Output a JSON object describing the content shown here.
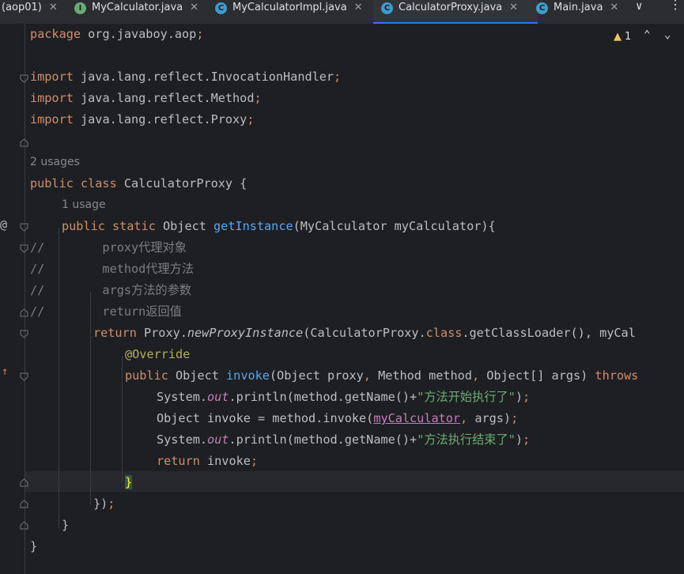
{
  "tabs": [
    {
      "label": "(aop01)",
      "icon": "",
      "active": false
    },
    {
      "label": "MyCalculator.java",
      "icon": "interface-icon",
      "active": false
    },
    {
      "label": "MyCalculatorImpl.java",
      "icon": "class-icon",
      "active": false
    },
    {
      "label": "CalculatorProxy.java",
      "icon": "class-icon",
      "active": true
    },
    {
      "label": "Main.java",
      "icon": "class-icon",
      "active": false
    }
  ],
  "inspection": {
    "count": "1"
  },
  "hints": {
    "class_usages": "2 usages",
    "method_usages": "1 usage"
  },
  "colors": {
    "keyword": "#cf8e6d",
    "function": "#56a8f5",
    "string": "#6aab73",
    "comment": "#7a7e85",
    "annotation": "#b3ae60",
    "static_field": "#c77dbb",
    "accent": "#3574f0"
  },
  "code": {
    "l1": {
      "kw": "package",
      "rest": " org.javaboy.aop",
      "semi": ";"
    },
    "l3": {
      "kw": "import",
      "rest": " java.lang.reflect.InvocationHandler",
      "semi": ";"
    },
    "l4": {
      "kw": "import",
      "rest": " java.lang.reflect.Method",
      "semi": ";"
    },
    "l5": {
      "kw": "import",
      "rest": " java.lang.reflect.Proxy",
      "semi": ";"
    },
    "l7": {
      "kw": "public class",
      "rest": " CalculatorProxy {"
    },
    "l8": {
      "kw": "public static",
      "t1": " Object ",
      "fn": "getInstance",
      "rest": "(MyCalculator myCalculator){"
    },
    "l9": {
      "text": "//        proxy代理对象"
    },
    "l10": {
      "text": "//        method代理方法"
    },
    "l11": {
      "text": "//        args方法的参数"
    },
    "l12": {
      "text": "//        return返回值"
    },
    "l13": {
      "kw": "return",
      "t1": " Proxy.",
      "im": "newProxyInstance",
      "t2": "(CalculatorProxy.",
      "kw2": "class",
      "t3": ".getClassLoader(), myCal"
    },
    "l14": {
      "text": "@Override"
    },
    "l15": {
      "kw": "public",
      "t1": " Object ",
      "fn": "invoke",
      "t2": "(Object proxy",
      "c1": ",",
      "t3": " Method method",
      "c2": ",",
      "t4": " Object[] args) ",
      "kw2": "throws"
    },
    "l16": {
      "t1": "System.",
      "sf": "out",
      "t2": ".println(method.getName()+",
      "st": "\"方法开始执行了\"",
      "t3": ")",
      "semi": ";"
    },
    "l17": {
      "t1": "Object invoke = method.invoke(",
      "fd": "myCalculator",
      "c1": ",",
      "t2": " args)",
      "semi": ";"
    },
    "l18": {
      "t1": "System.",
      "sf": "out",
      "t2": ".println(method.getName()+",
      "st": "\"方法执行结束了\"",
      "t3": ")",
      "semi": ";"
    },
    "l19": {
      "kw": "return",
      "t1": " invoke",
      "semi": ";"
    },
    "l20": {
      "text": "}"
    },
    "l21": {
      "text": "})",
      "semi": ";"
    },
    "l22": {
      "text": "}"
    },
    "l23": {
      "text": "}"
    }
  }
}
